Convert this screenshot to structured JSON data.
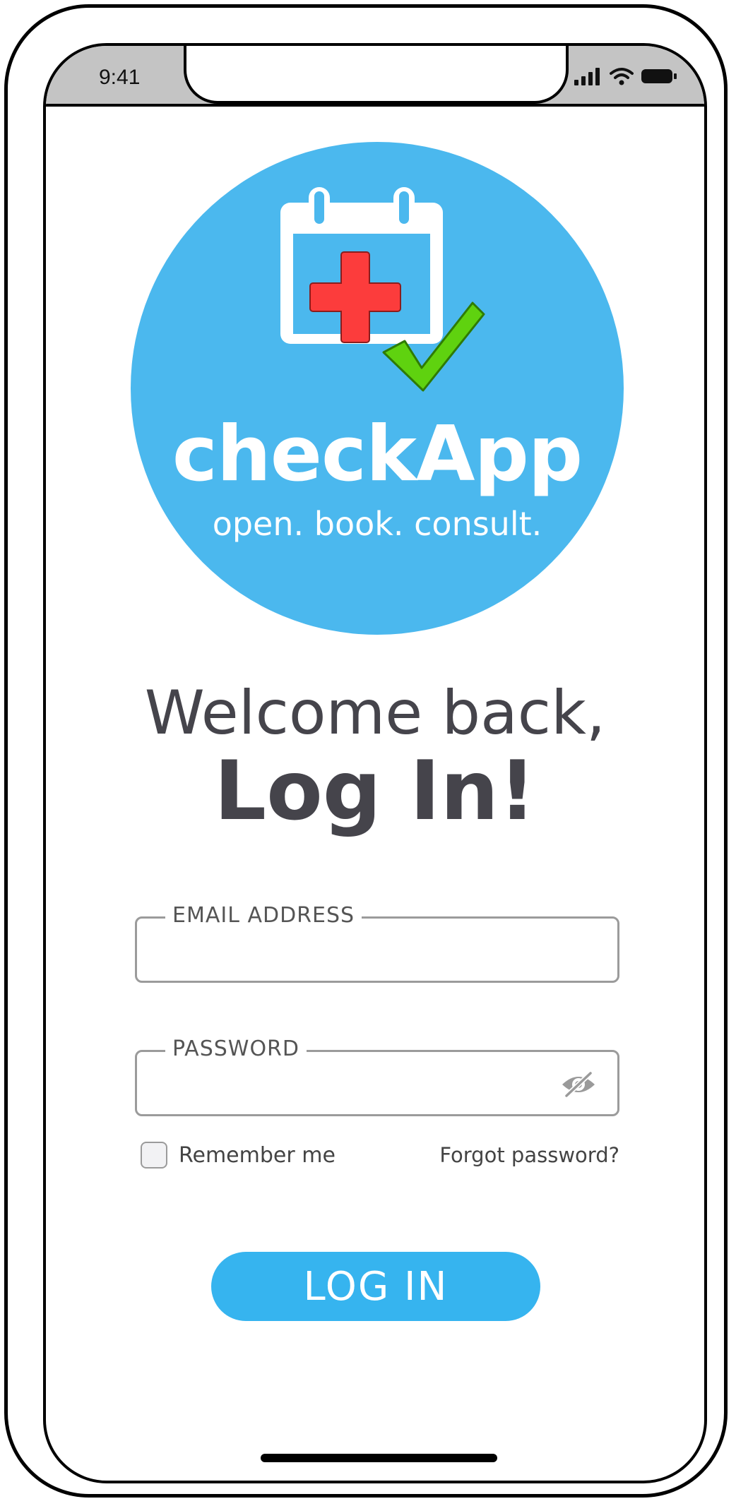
{
  "status_bar": {
    "time": "9:41",
    "icons": [
      "signal-icon",
      "wifi-icon",
      "battery-icon"
    ]
  },
  "logo": {
    "name": "checkApp",
    "tagline": "open. book. consult.",
    "icon": "calendar-medical-check-icon",
    "colors": {
      "circle": "#4bb8ee",
      "cross": "#fc3c3c",
      "check": "#5fd20f"
    }
  },
  "heading": {
    "welcome": "Welcome back,",
    "title": "Log In!"
  },
  "form": {
    "email_label": "EMAIL ADDRESS",
    "email_value": "",
    "password_label": "PASSWORD",
    "password_value": "",
    "password_toggle_icon": "eye-slash-icon",
    "remember_label": "Remember me",
    "remember_checked": false,
    "forgot_label": "Forgot password?",
    "submit_label": "LOG IN",
    "submit_color": "#36b4ef"
  }
}
